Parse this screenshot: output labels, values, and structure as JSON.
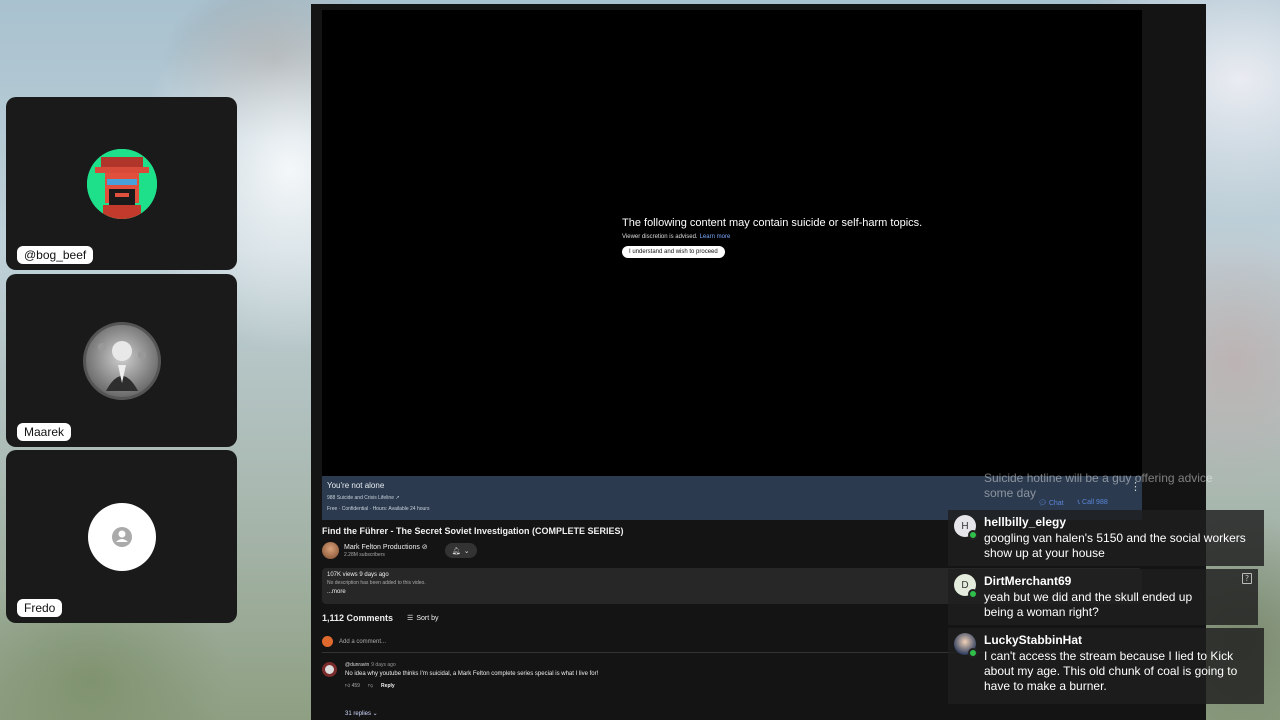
{
  "participants": [
    {
      "name": "@bog_beef"
    },
    {
      "name": "Maarek"
    },
    {
      "name": "Fredo"
    }
  ],
  "video": {
    "warning_title": "The following content may contain suicide or self-harm topics.",
    "warning_sub": "Viewer discretion is advised.",
    "learn_more": "Learn more",
    "proceed_button": "I understand and wish to proceed",
    "crisis_title": "You're not alone",
    "crisis_line": "988 Suicide and Crisis Lifeline ↗",
    "crisis_hours": "Free · Confidential · Hours: Available 24 hours",
    "chat_link": "Chat",
    "call_link": "Call 988",
    "title": "Find the Führer - The Secret Soviet Investigation (COMPLETE SERIES)",
    "channel_name": "Mark Felton Productions ⊘",
    "channel_subs": "2.28M subscribers",
    "meta": "107K views  9 days ago",
    "no_desc": "No description has been added to this video.",
    "more": "...more",
    "comment_count": "1,112 Comments",
    "sort_by": "Sort by",
    "add_comment": "Add a comment...",
    "comment": {
      "author": "@dunravin",
      "age": "9 days ago",
      "text": "No idea why youtube thinks I'm suicidal, a Mark Felton complete series special is what I live for!",
      "likes": "459",
      "reply": "Reply",
      "replies": "31 replies"
    }
  },
  "chat": {
    "faded_text": "Suicide hotline will be a guy offering advice some day",
    "messages": [
      {
        "initial": "H",
        "user": "hellbilly_elegy",
        "text": "googling van halen's 5150 and the social workers show up at your house"
      },
      {
        "initial": "D",
        "user": "DirtMerchant69",
        "text": "yeah but we did and the skull ended up being a woman right?"
      },
      {
        "initial": "",
        "user": "LuckyStabbinHat",
        "text": "I can't access the stream because I lied to Kick about my age. This old chunk of coal is going to have to make a burner."
      }
    ]
  },
  "colors": {
    "badge": "#2fbf4a",
    "crisis_panel": "#2b3a4e",
    "link": "#5a86d8"
  }
}
